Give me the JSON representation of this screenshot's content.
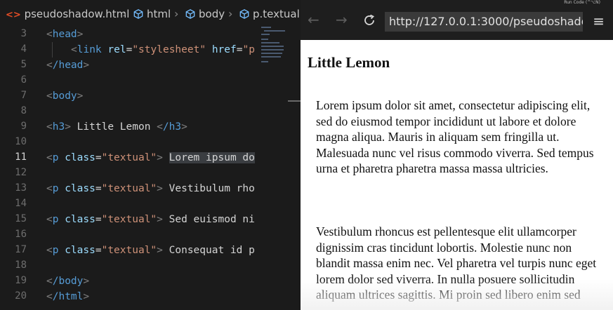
{
  "editor": {
    "breadcrumb": [
      {
        "label": "pseudoshadow.html",
        "icon": "html-file-icon"
      },
      {
        "label": "html",
        "icon": "symbol-cube-icon"
      },
      {
        "label": "body",
        "icon": "symbol-cube-icon"
      },
      {
        "label": "p.textual",
        "icon": "symbol-cube-icon"
      }
    ],
    "line_numbers": [
      "3",
      "4",
      "5",
      "6",
      "7",
      "8",
      "9",
      "10",
      "11",
      "12",
      "13",
      "14",
      "15",
      "16",
      "17",
      "18",
      "19",
      "20"
    ],
    "active_line": "11",
    "code": {
      "l3_tag": "head",
      "l4_tag": "link",
      "l4_attr1": "rel",
      "l4_val1": "\"stylesheet\"",
      "l4_attr2": "href",
      "l4_val2": "\"p",
      "l5_tag": "/head",
      "l7_tag": "body",
      "l9_tag": "h3",
      "l9_text": " Little Lemon ",
      "l9_close": "/h3",
      "p_tag": "p",
      "p_attr": "class",
      "p_val": "\"textual\"",
      "l11_text": "Lorem ipsum do",
      "l13_text": "Vestibulum rho",
      "l15_text": "Sed euismod ni",
      "l17_text": "Consequat id p",
      "l19_tag": "/body",
      "l20_tag": "/html"
    }
  },
  "browser": {
    "run_code_hint": "Run Code (^⌥N)",
    "url": "http://127.0.0.1:3000/pseudoshadow.html",
    "page": {
      "heading": "Little Lemon",
      "paragraph_1": "Lorem ipsum dolor sit amet, consectetur adipiscing elit, sed do eiusmod tempor incididunt ut labore et dolore magna aliqua. Mauris in aliquam sem fringilla ut. Malesuada nunc vel risus commodo viverra. Sed tempus urna et pharetra pharetra massa massa ultricies.",
      "paragraph_2": "Vestibulum rhoncus est pellentesque elit ullamcorper dignissim cras tincidunt lobortis. Molestie nunc non blandit massa enim nec. Vel pharetra vel turpis nunc eget lorem dolor sed viverra. In nulla posuere sollicitudin aliquam ultrices sagittis. Mi proin sed libero enim sed"
    }
  },
  "colors": {
    "tag": "#569cd6",
    "attribute": "#9cdcfe",
    "string": "#ce9178",
    "text": "#d4d4d4",
    "editor_bg": "#1b1b1b",
    "page_bg": "#ffffff"
  }
}
